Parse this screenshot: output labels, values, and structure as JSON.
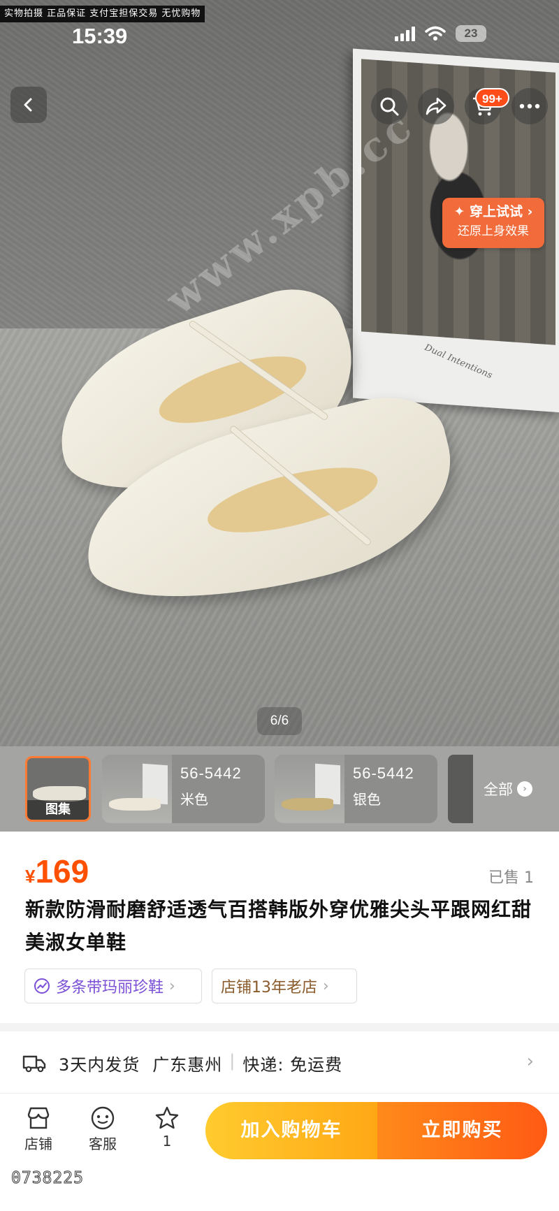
{
  "top_banner": "实物拍摄 正品保证 支付宝担保交易 无忧购物",
  "status_bar": {
    "time": "15:39",
    "battery": "23"
  },
  "header": {
    "back_icon": "chevron-left-icon",
    "cart_badge": "99+",
    "icons": [
      "search-icon",
      "share-icon",
      "cart-icon",
      "more-icon"
    ]
  },
  "watermark": "www.xpb.cc",
  "book_caption": "Dual Intentions",
  "try_on": {
    "line1": "✦ 穿上试试 ›",
    "line2": "还原上身效果"
  },
  "image_counter": "6/6",
  "thumbnails": {
    "gallery_label": "图集",
    "variants": [
      {
        "code": "56-5442",
        "color": "米色",
        "shoe_color": "#ece7d8"
      },
      {
        "code": "56-5442",
        "color": "银色",
        "shoe_color": "#c9b27a"
      }
    ],
    "all_label": "全部",
    "all_icon": "chevron-right-icon"
  },
  "product": {
    "currency": "¥",
    "price": "169",
    "sold": "已售 1",
    "title": "新款防滑耐磨舒适透气百搭韩版外穿优雅尖头平跟网红甜美淑女单鞋",
    "tags": [
      {
        "label": "多条带玛丽珍鞋",
        "icon": "trend-icon"
      },
      {
        "label": "店铺13年老店",
        "icon": ""
      }
    ]
  },
  "shipping": {
    "icon": "truck-icon",
    "delivery": "3天内发货",
    "location": "广东惠州",
    "express": "快递: 免运费"
  },
  "bottom_bar": {
    "store": "店铺",
    "service": "客服",
    "favorite_count": "1",
    "add_to_cart": "加入购物车",
    "buy_now": "立即购买"
  },
  "image_id": "0738225",
  "colors": {
    "accent": "#ff5000",
    "cart_button": "#ffb01f",
    "buy_button": "#ff6a14",
    "tryon": "#f26b3a"
  }
}
